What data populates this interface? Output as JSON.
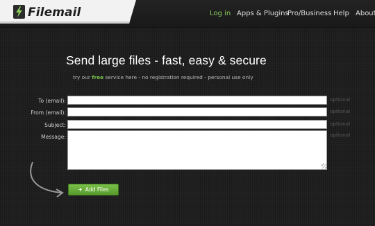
{
  "brand": {
    "name": "Filemail",
    "accent": "#8ccc5a"
  },
  "nav": [
    {
      "label": "Log in",
      "active": true
    },
    {
      "label": "Apps & Plugins"
    },
    {
      "label": "Pro/Business"
    },
    {
      "label": "Help"
    },
    {
      "label": "About"
    }
  ],
  "hero": {
    "headline": "Send large files - fast, easy & secure",
    "tagline_pre": "try our",
    "tagline_free": "free",
    "tagline_post": "service here - no registration required - personal use only"
  },
  "form": {
    "to_label": "To (email):",
    "from_label": "From (email):",
    "subject_label": "Subject:",
    "message_label": "Message:",
    "optional_text": "optional",
    "to_value": "",
    "from_value": "",
    "subject_value": "",
    "message_value": ""
  },
  "add_files": {
    "icon": "plus-icon",
    "label": "Add Files"
  }
}
